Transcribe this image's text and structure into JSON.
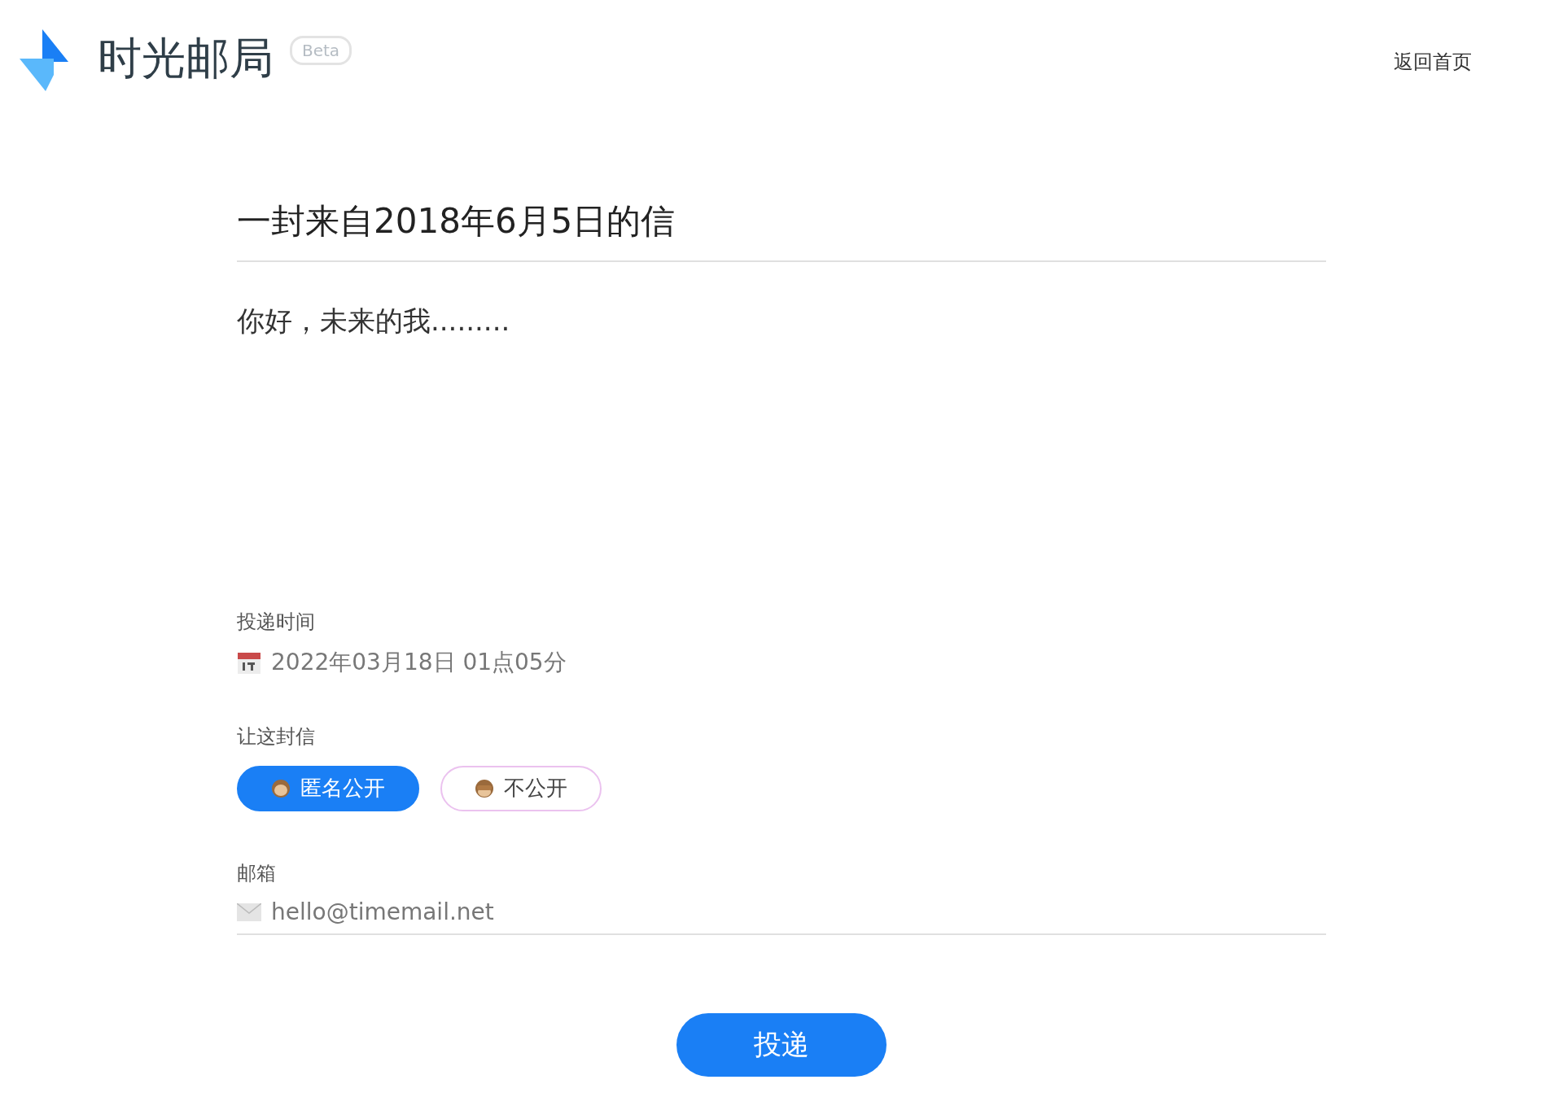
{
  "header": {
    "brand": "时光邮局",
    "badge": "Beta",
    "home_link": "返回首页"
  },
  "letter": {
    "title": "一封来自2018年6月5日的信",
    "body": "你好，未来的我........."
  },
  "delivery": {
    "label": "投递时间",
    "value": "2022年03月18日 01点05分"
  },
  "visibility": {
    "label": "让这封信",
    "options": [
      {
        "label": "匿名公开",
        "selected": true,
        "kind": "open"
      },
      {
        "label": "不公开",
        "selected": false,
        "kind": "hidden"
      }
    ]
  },
  "email": {
    "label": "邮箱",
    "placeholder": "hello@timemail.net"
  },
  "submit": "投递"
}
